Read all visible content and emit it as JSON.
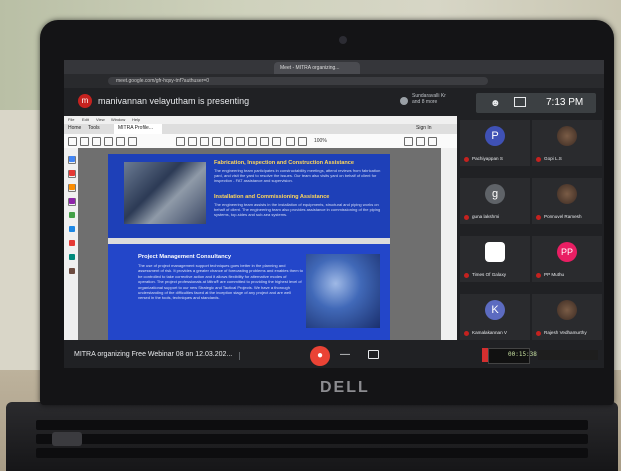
{
  "meeting": {
    "presenter_initial": "m",
    "presenter_banner": "manivannan velayutham is presenting",
    "pinned_line1": "Sundaravalli Kr",
    "pinned_line2": "and 8 more",
    "time": "7:13 PM",
    "meeting_name": "MITRA organizing Free Webinar 08 on 12.03.202...",
    "browser_tab": "Meet - MITRA organizing...",
    "url": "meet.google.com/gfr-hqsy-tnf?authuser=0"
  },
  "pdf_viewer": {
    "menu": [
      "File",
      "Edit",
      "View",
      "Window",
      "Help"
    ],
    "tabs": [
      "Home",
      "Tools",
      "MITRA Profile..."
    ],
    "sign_in": "Sign In",
    "zoom": "100%"
  },
  "document": {
    "section1_title": "Fabrication, Inspection and Construction Assistance",
    "section1_body": "The engineering team participates in constructability meetings, attend reviews from fabrication yard, and visit the yard to resolve the issues. Our team also visits yard on behalf of client for inspection - FAT assistance and supervision.",
    "section2_title": "Installation and Commissioning Assistance",
    "section2_body": "The engineering team assists in the installation of equipments, structural and piping works on behalf of client. The engineering team also provides assistance in commissioning of the piping systems, top-sides and sub-sea systems.",
    "section3_title": "Project Management Consultancy",
    "section3_body": "The use of project management support techniques goes better in the planning and assessment of risk. It provides a greater chance of forecasting problems and enables them to be controlled to take corrective action and it allows flexibility for alternative modes of operation. The project professionals at Mitra® are committed to providing the highest level of organizational support to our new Strategic and Tactical Projects. We have a thorough understanding of the difficulties faced at the inception stage of any project and are well versed in the tools, techniques and standards."
  },
  "participants": [
    {
      "name": "Pachiyappan S",
      "initial": "P",
      "color": "#3f51b5"
    },
    {
      "name": "Gopi L.S",
      "initial": "",
      "color": ""
    },
    {
      "name": "guna lakshmi",
      "initial": "g",
      "color": "#5f6368"
    },
    {
      "name": "Ponnuvel Ramesh",
      "initial": "",
      "color": ""
    },
    {
      "name": "Times Of Galaxy",
      "initial": "",
      "color": "#ffffff"
    },
    {
      "name": "PP Muthu",
      "initial": "PP",
      "color": "#e91e63"
    },
    {
      "name": "Kamalakannan V",
      "initial": "K",
      "color": "#5c6bc0"
    },
    {
      "name": "Rajesh Vedhamurthy",
      "initial": "",
      "color": ""
    }
  ],
  "recorder": {
    "elapsed": "00:15:38"
  },
  "tray_time": "7:13 PM",
  "brand": "DELL"
}
